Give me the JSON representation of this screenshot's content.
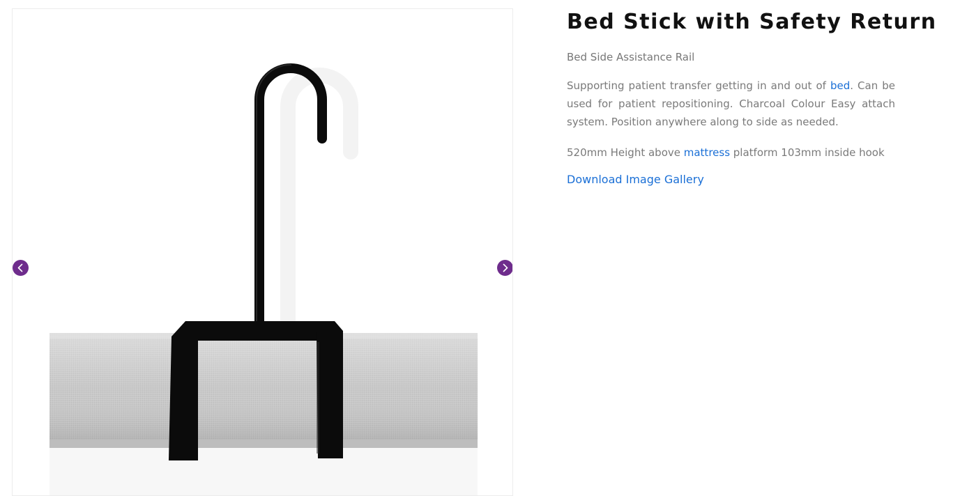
{
  "product": {
    "title": "Bed Stick with Safety Return",
    "subtitle": "Bed Side Assistance Rail",
    "description": {
      "text_before": "Supporting patient transfer getting in and out of ",
      "link_text": "bed",
      "text_after": ". Can be used for patient repositioning. Charcoal Colour Easy attach system. Position anywhere along to side as needed."
    },
    "dimensions": {
      "text_before": "520mm Height above ",
      "link_text": "mattress",
      "text_after": " platform 103mm inside hook"
    },
    "download_label": "Download Image Gallery"
  },
  "gallery": {
    "prev_icon": "chevron-left-icon",
    "next_icon": "chevron-right-icon",
    "accent_color": "#6e2c8c",
    "image_subject": "black bed stick hooked over grey mattress"
  },
  "colors": {
    "link": "#1a6fd6",
    "title": "#111111",
    "body_text": "#7a7a7a"
  }
}
